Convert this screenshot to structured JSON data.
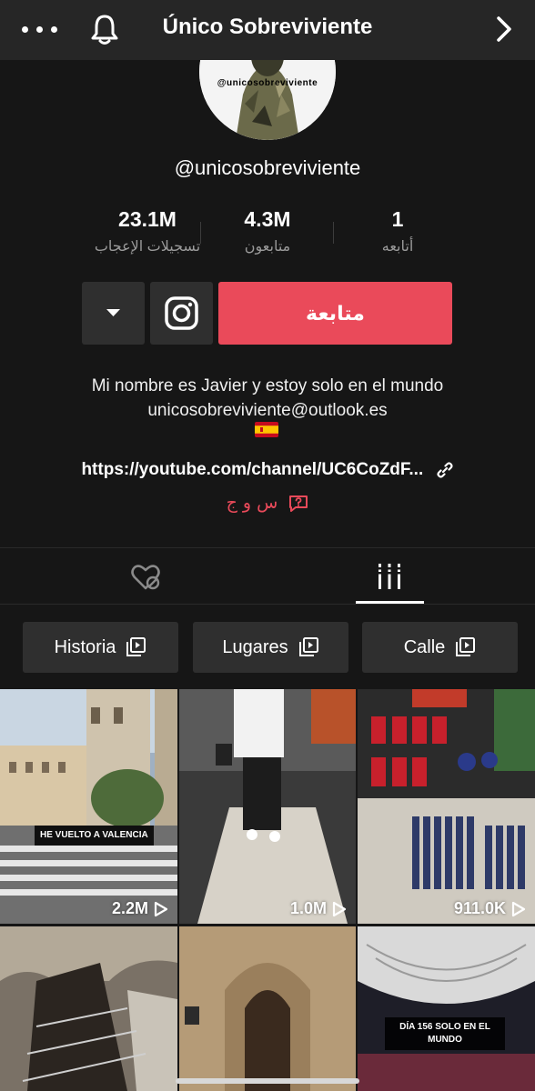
{
  "header": {
    "title": "Único Sobreviviente"
  },
  "profile": {
    "avatar_text": "@unicosobreviviente",
    "username": "@unicosobreviviente"
  },
  "stats": [
    {
      "value": "23.1M",
      "label": "تسجيلات الإعجاب"
    },
    {
      "value": "4.3M",
      "label": "متابعون"
    },
    {
      "value": "1",
      "label": "أتابعه"
    }
  ],
  "actions": {
    "follow_label": "متابعة"
  },
  "bio": {
    "line1": "Mi nombre es Javier y estoy solo en el mundo",
    "line2": "unicosobreviviente@outlook.es",
    "link": "https://youtube.com/channel/UC6CoZdF...",
    "qa": "س و ج"
  },
  "playlists": [
    {
      "label": "Historia"
    },
    {
      "label": "Lugares"
    },
    {
      "label": "Calle"
    }
  ],
  "videos": [
    {
      "views": "2.2M",
      "caption": "HE VUELTO A VALENCIA"
    },
    {
      "views": "1.0M",
      "caption": ""
    },
    {
      "views": "911.0K",
      "caption": ""
    },
    {
      "views": "",
      "caption": ""
    },
    {
      "views": "",
      "caption": ""
    },
    {
      "views": "",
      "caption": "DÍA 156 SOLO EN EL MUNDO"
    }
  ],
  "colors": {
    "accent": "#ea4a5a",
    "background": "#161616",
    "header": "#262626",
    "button": "#2f2f2f"
  }
}
